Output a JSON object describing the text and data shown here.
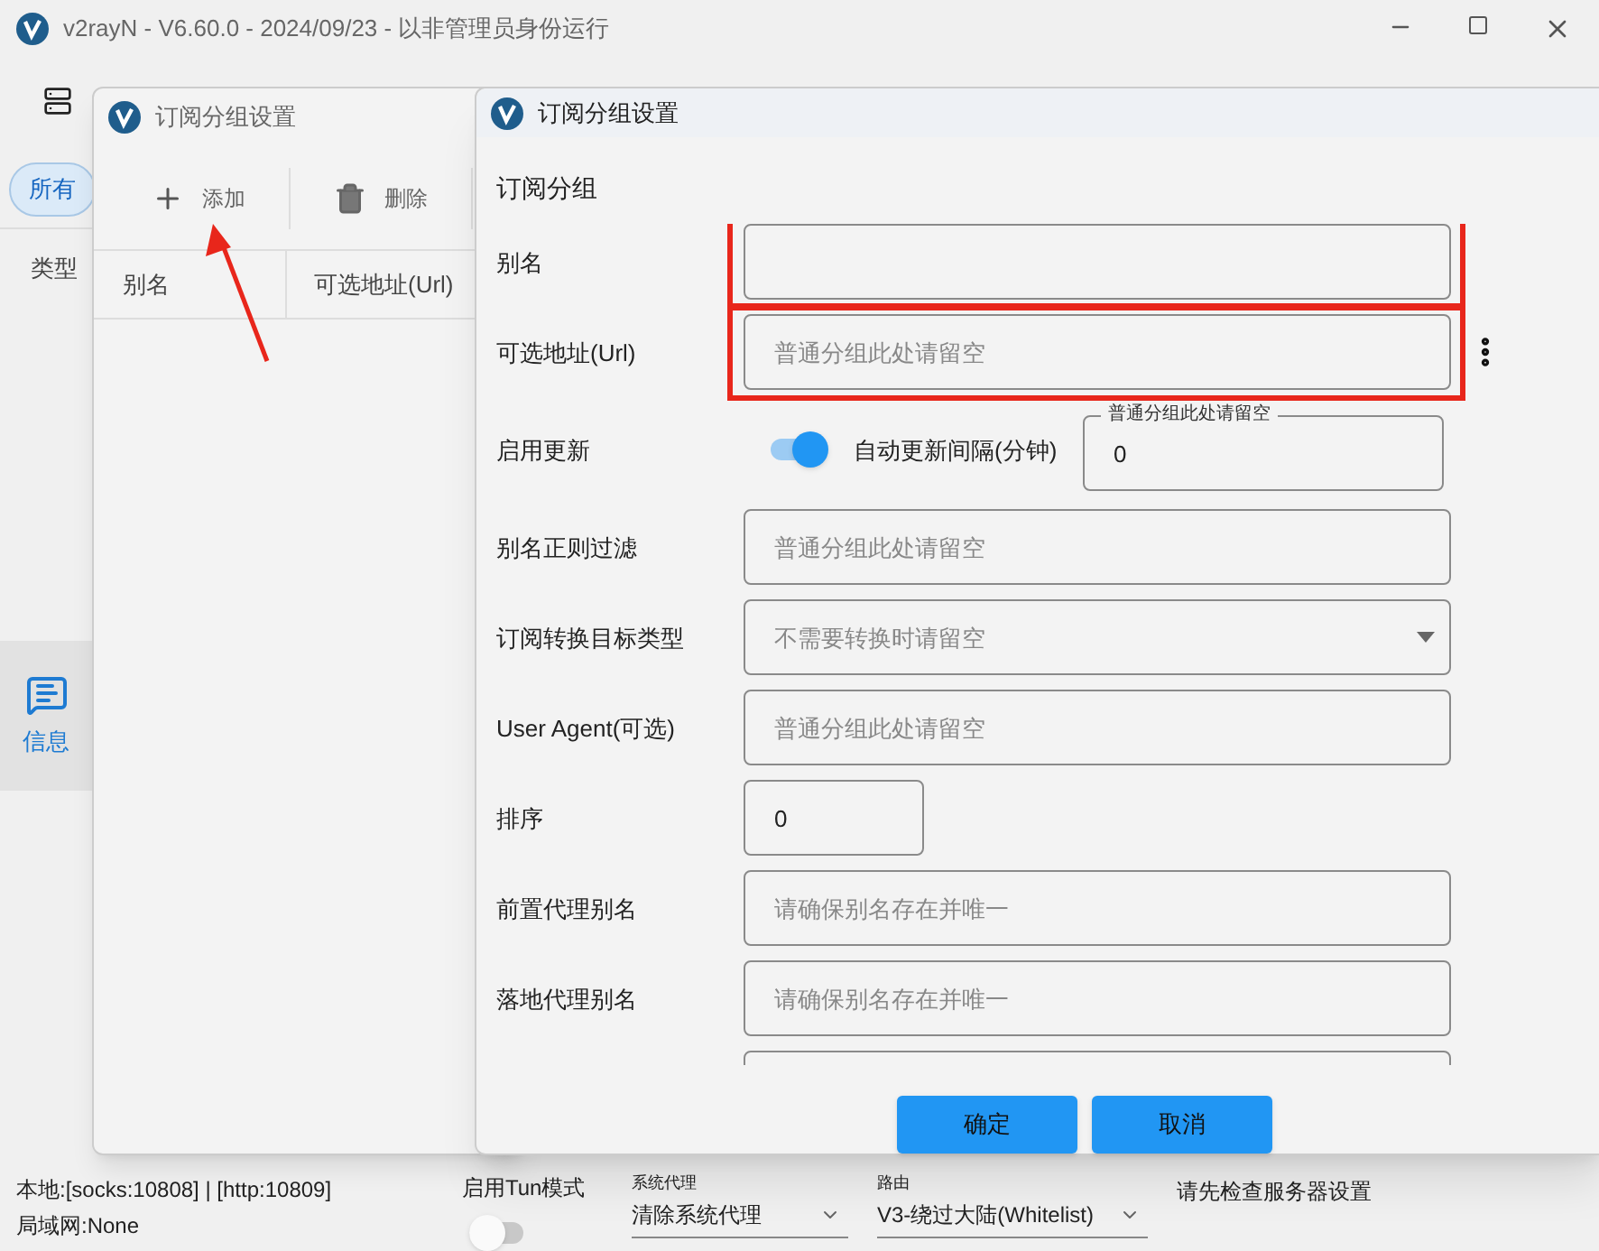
{
  "main_window": {
    "title": "v2rayN - V6.60.0 - 2024/09/23 - 以非管理员身份运行",
    "filter_chip": {
      "label": "所有",
      "selected": true
    },
    "column_header": "类型",
    "nav_item": {
      "label": "信息",
      "selected": true
    },
    "status_bar": {
      "local": "本地:[socks:10808] | [http:10809]",
      "lan": "局域网:None",
      "tun": {
        "label": "启用Tun模式",
        "on": false
      },
      "system_proxy": {
        "label": "系统代理",
        "value": "清除系统代理"
      },
      "routing": {
        "label": "路由",
        "value": "V3-绕过大陆(Whitelist)"
      },
      "message": "请先检查服务器设置"
    }
  },
  "list_window": {
    "title": "订阅分组设置",
    "toolbar": [
      {
        "kind": "add",
        "label": "添加"
      },
      {
        "kind": "delete",
        "label": "删除"
      }
    ],
    "columns": [
      "别名",
      "可选地址(Url)"
    ]
  },
  "dialog": {
    "title": "订阅分组设置",
    "section": "订阅分组",
    "fields": [
      {
        "kind": "text",
        "label": "别名",
        "highlighted": true
      },
      {
        "kind": "text",
        "label": "可选地址(Url)",
        "placeholder": "普通分组此处请留空",
        "highlighted": true,
        "menu": true
      },
      {
        "kind": "toggle",
        "label": "启用更新",
        "on": true,
        "interval_label": "自动更新间隔(分钟)",
        "interval_hint": "普通分组此处请留空",
        "interval_value": "0"
      },
      {
        "kind": "text",
        "label": "别名正则过滤",
        "placeholder": "普通分组此处请留空"
      },
      {
        "kind": "select",
        "label": "订阅转换目标类型",
        "placeholder": "不需要转换时请留空"
      },
      {
        "kind": "text",
        "label": "User Agent(可选)",
        "placeholder": "普通分组此处请留空"
      },
      {
        "kind": "short",
        "label": "排序",
        "value": "0"
      },
      {
        "kind": "text",
        "label": "前置代理别名",
        "placeholder": "请确保别名存在并唯一"
      },
      {
        "kind": "text",
        "label": "落地代理别名",
        "placeholder": "请确保别名存在并唯一"
      },
      {
        "kind": "text"
      }
    ],
    "buttons": [
      {
        "kind": "primary",
        "label": "确定"
      },
      {
        "kind": "primary",
        "label": "取消"
      }
    ]
  }
}
